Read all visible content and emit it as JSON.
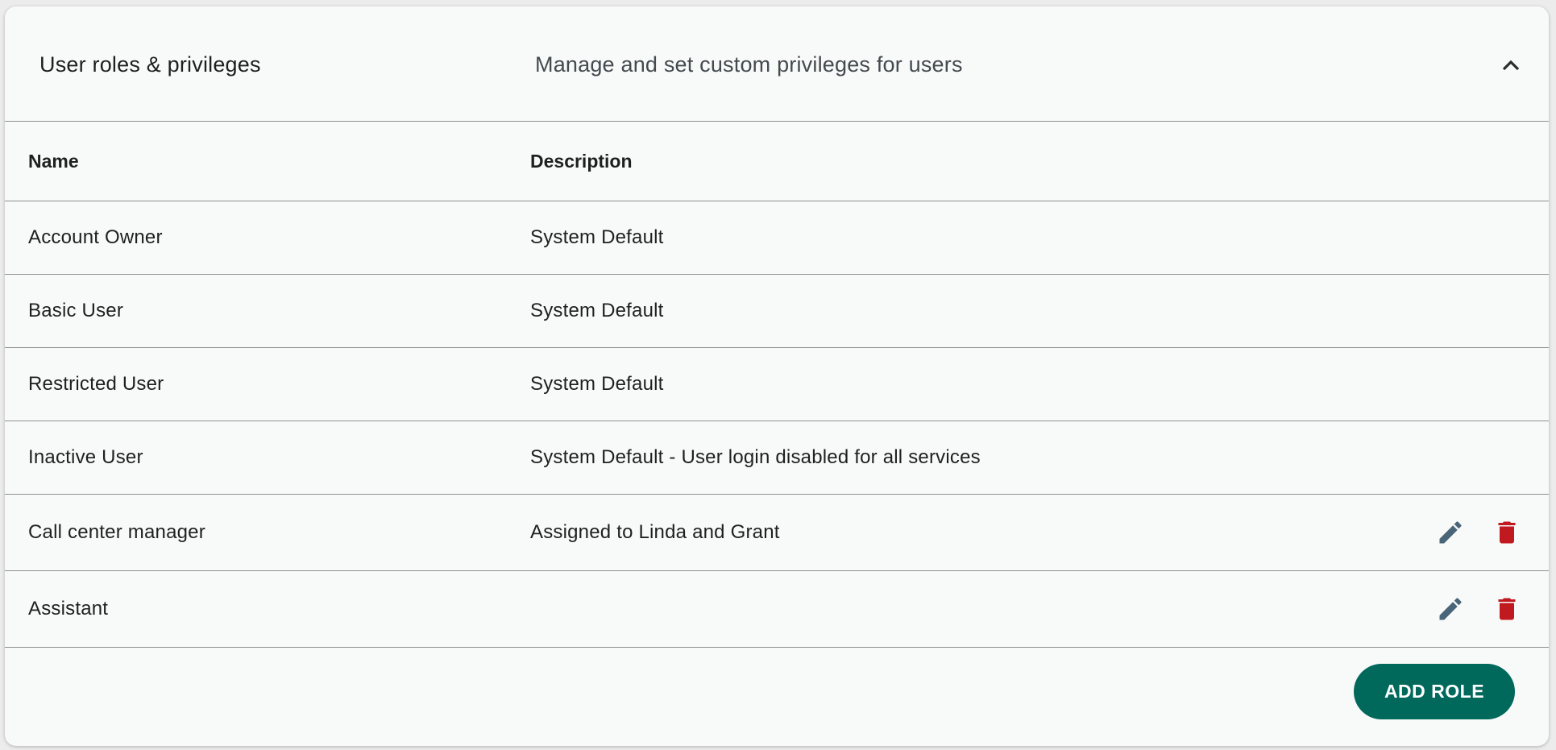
{
  "header": {
    "title": "User roles & privileges",
    "subtitle": "Manage and set custom privileges for users",
    "collapse_icon": "chevron-up-icon"
  },
  "table": {
    "columns": [
      "Name",
      "Description"
    ],
    "rows": [
      {
        "name": "Account Owner",
        "description": "System Default",
        "editable": false
      },
      {
        "name": "Basic User",
        "description": "System Default",
        "editable": false
      },
      {
        "name": "Restricted User",
        "description": "System Default",
        "editable": false
      },
      {
        "name": "Inactive User",
        "description": "System Default - User login disabled for all services",
        "editable": false
      },
      {
        "name": "Call center manager",
        "description": "Assigned to Linda and Grant",
        "editable": true
      },
      {
        "name": "Assistant",
        "description": "",
        "editable": true
      }
    ],
    "edit_icon": "pencil-icon",
    "delete_icon": "trash-icon"
  },
  "footer": {
    "add_role_label": "ADD ROLE"
  },
  "colors": {
    "accent": "#00695c",
    "edit_icon": "#4a6478",
    "delete_icon": "#c0191f",
    "card_bg": "#f8faf9",
    "divider": "#8f8f8f"
  }
}
